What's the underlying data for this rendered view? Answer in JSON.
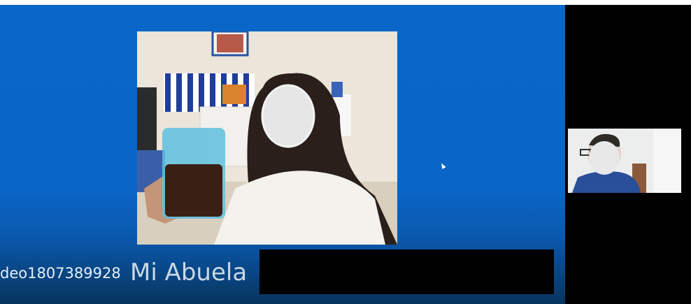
{
  "participants": {
    "main": {
      "id_text": "deo1807389928",
      "name": "Mi Abuela"
    }
  },
  "colors": {
    "stage_blue": "#0a66c6",
    "sidebar_black": "#000000",
    "caption_text": "#e6eef6"
  },
  "icons": {
    "pointer": "mouse-pointer-icon"
  }
}
